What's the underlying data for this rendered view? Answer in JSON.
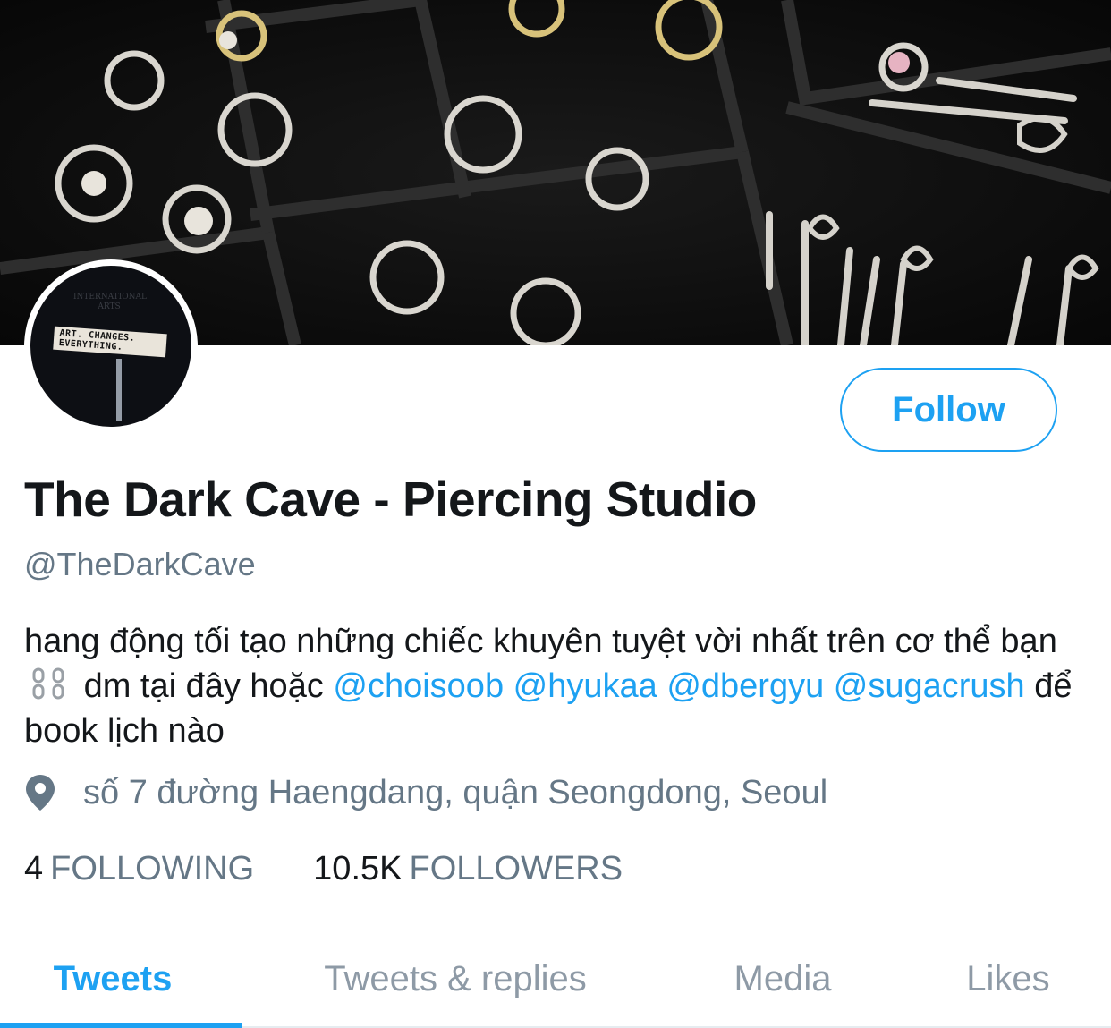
{
  "profile": {
    "display_name": "The Dark Cave - Piercing Studio",
    "handle": "@TheDarkCave",
    "avatar_sign": "ART. CHANGES. EVERYTHING.",
    "avatar_top": "INTERNATIONAL ARTS",
    "bio": {
      "part1": "hang động tối tạo những chiếc khuyên tuyệt vời nhất trên cơ thể bạn",
      "part2": "dm tại đây hoặc",
      "mentions": [
        "@choisoob",
        "@hyukaa",
        "@dbergyu",
        "@sugacrush"
      ],
      "part3": "để book lịch nào"
    },
    "location": "số 7 đường Haengdang, quận Seongdong, Seoul",
    "following_count": "4",
    "following_label": "FOLLOWING",
    "followers_count": "10.5K",
    "followers_label": "FOLLOWERS"
  },
  "actions": {
    "follow_label": "Follow"
  },
  "tabs": [
    {
      "label": "Tweets",
      "active": true
    },
    {
      "label": "Tweets & replies",
      "active": false
    },
    {
      "label": "Media",
      "active": false
    },
    {
      "label": "Likes",
      "active": false
    }
  ],
  "colors": {
    "accent": "#1da1f2",
    "secondary_text": "#657786",
    "primary_text": "#14171a"
  },
  "icons": {
    "location": "map-pin-icon",
    "chain": "chain-icon"
  }
}
